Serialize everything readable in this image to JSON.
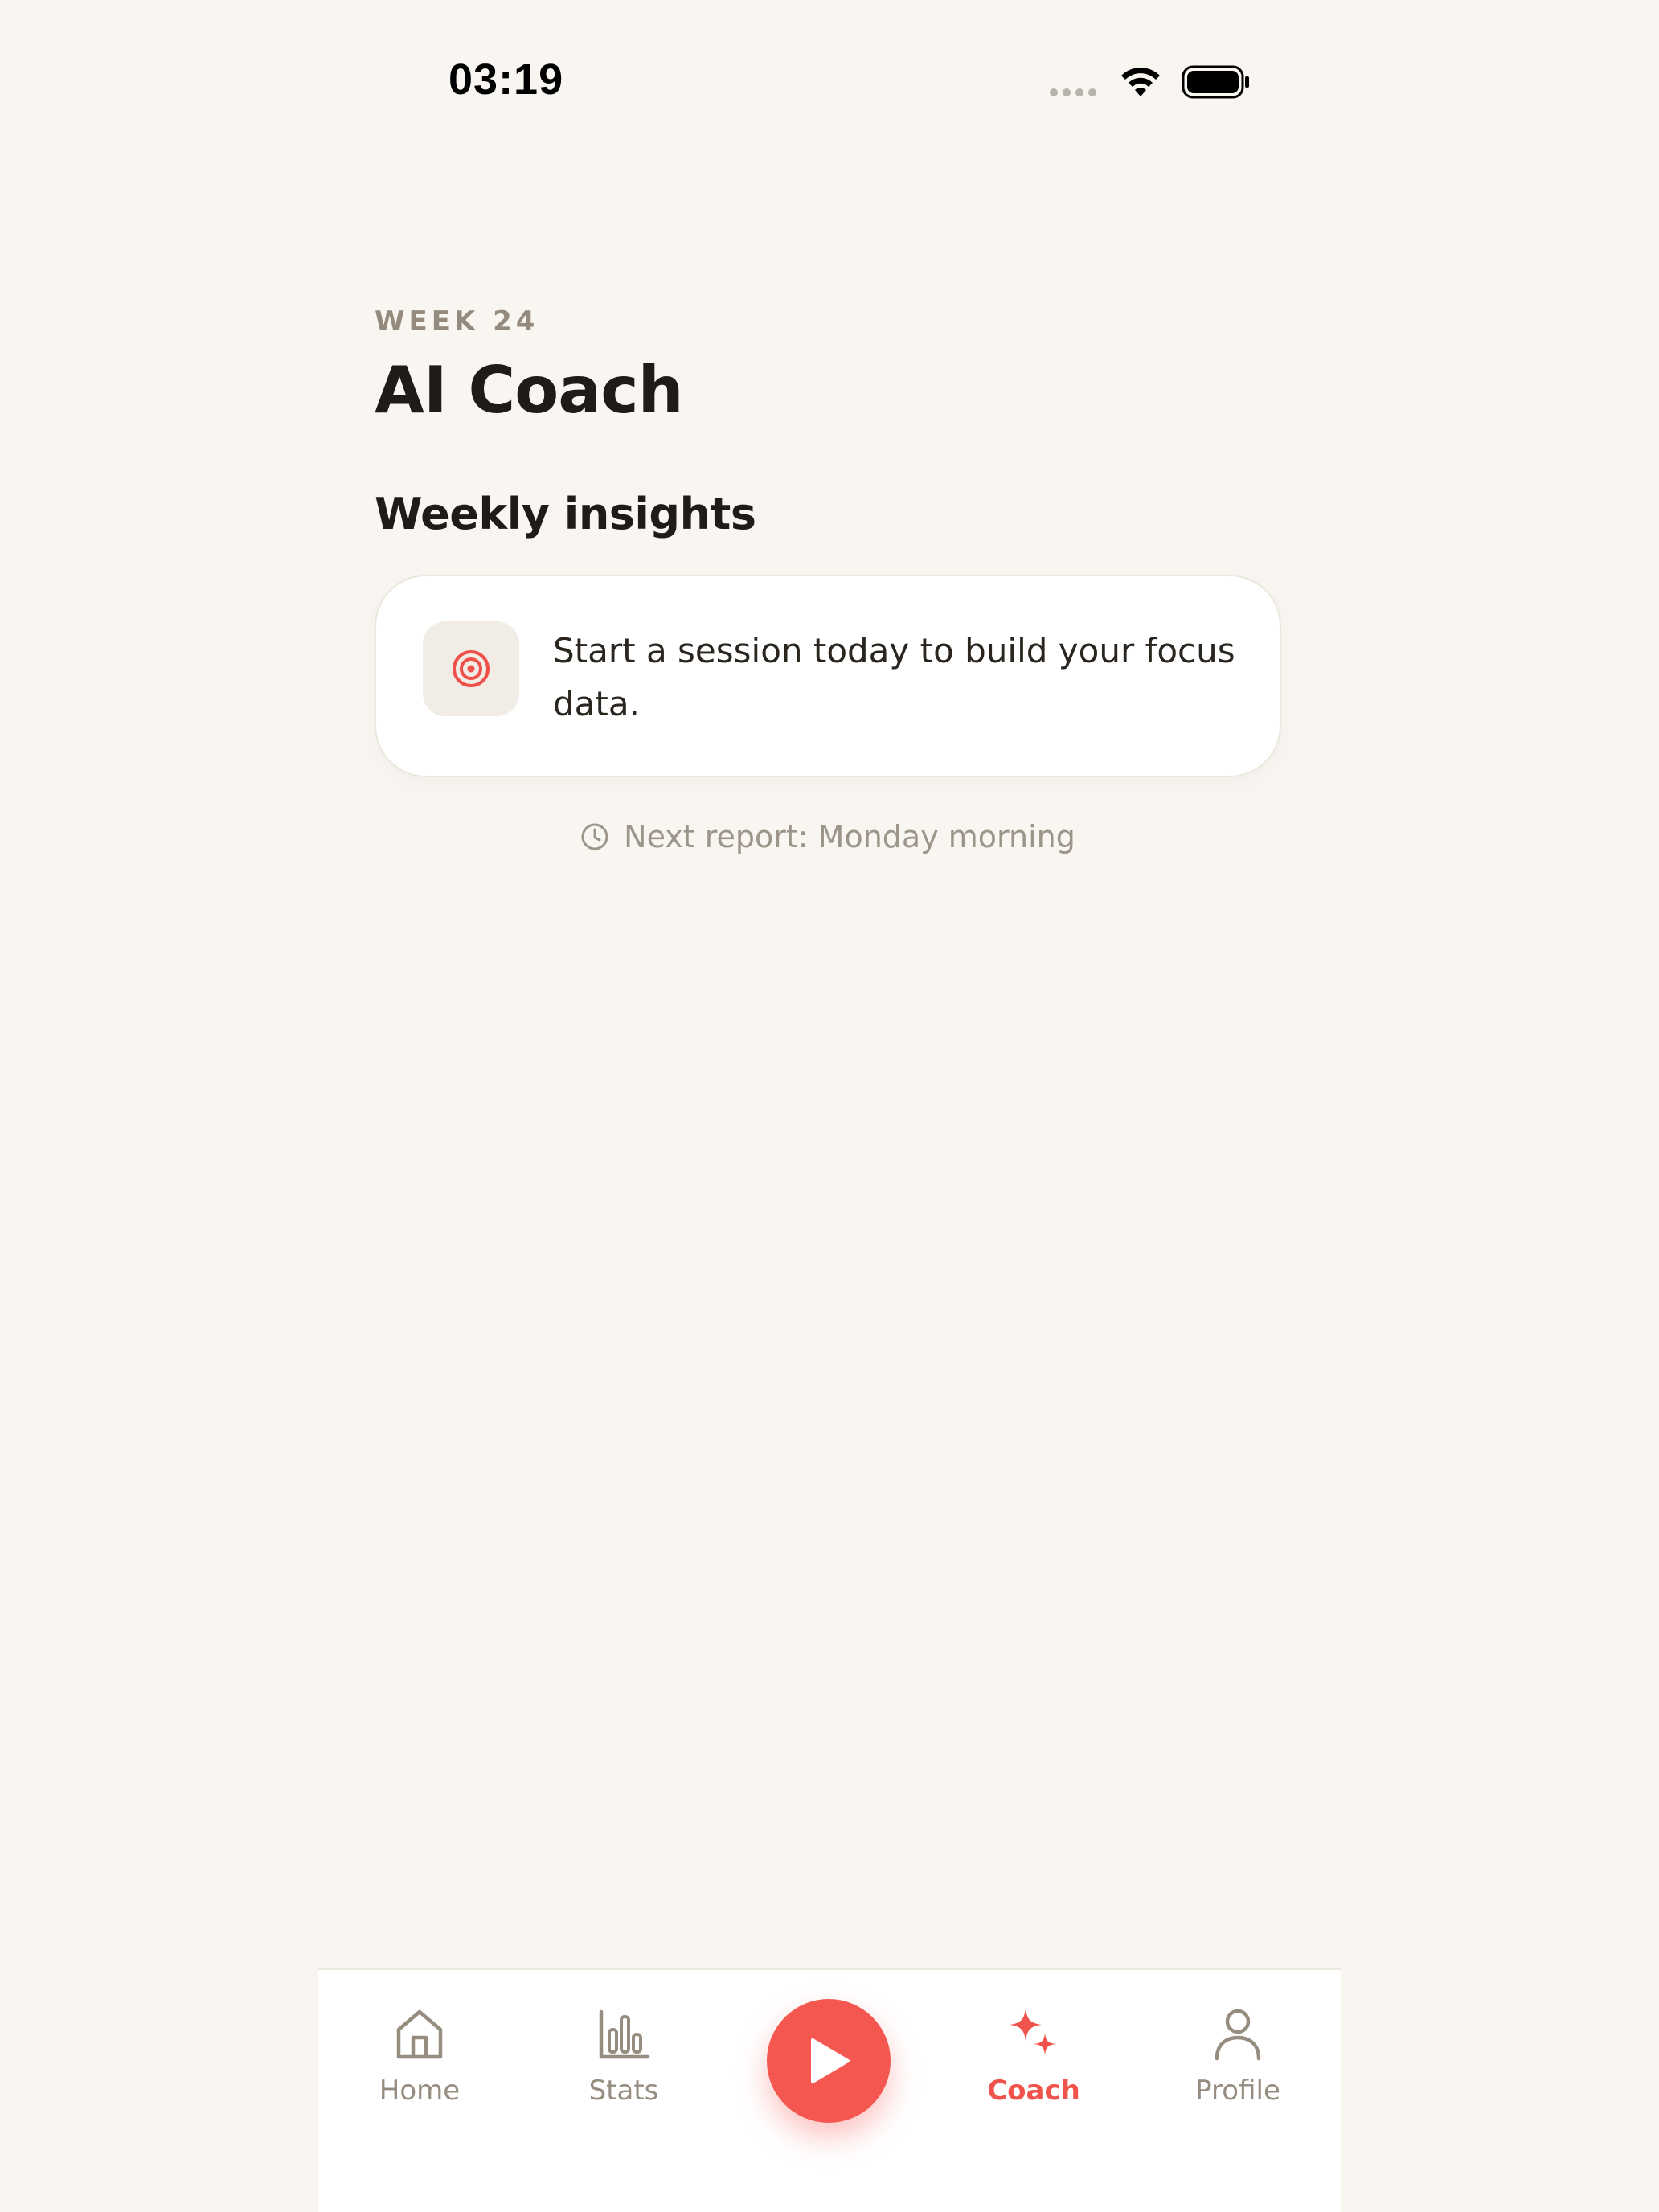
{
  "status_bar": {
    "time": "03:19"
  },
  "header": {
    "week_label": "WEEK 24",
    "title": "AI Coach"
  },
  "insights": {
    "section_title": "Weekly insights",
    "card_text": "Start a session today to build your focus data.",
    "card_icon": "target-icon",
    "next_report": "Next report: Monday morning"
  },
  "tab_bar": {
    "tabs": [
      {
        "label": "Home",
        "icon": "home-icon",
        "active": false
      },
      {
        "label": "Stats",
        "icon": "bar-chart-icon",
        "active": false
      },
      {
        "label": "Coach",
        "icon": "sparkles-icon",
        "active": true
      },
      {
        "label": "Profile",
        "icon": "person-icon",
        "active": false
      }
    ],
    "center_button_icon": "play-icon"
  },
  "colors": {
    "background": "#f9f6f1",
    "accent": "#f3574f",
    "muted_text": "#968d80",
    "primary_text": "#1f1b16"
  }
}
